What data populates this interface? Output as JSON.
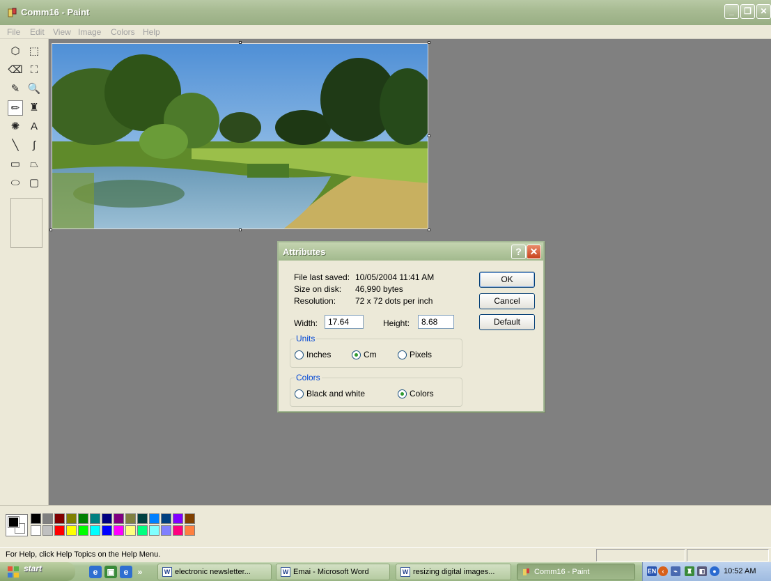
{
  "window": {
    "title": "Comm16  - Paint"
  },
  "menu": [
    "File",
    "Edit",
    "View",
    "Image",
    "Colors",
    "Help"
  ],
  "tools": [
    {
      "name": "free-form-select-icon",
      "glyph": "⬡"
    },
    {
      "name": "select-icon",
      "glyph": "⬚"
    },
    {
      "name": "eraser-icon",
      "glyph": "⌫"
    },
    {
      "name": "fill-with-color-icon",
      "glyph": "⛶"
    },
    {
      "name": "pick-color-icon",
      "glyph": "✎"
    },
    {
      "name": "magnifier-icon",
      "glyph": "🔍"
    },
    {
      "name": "pencil-icon",
      "glyph": "✏"
    },
    {
      "name": "brush-icon",
      "glyph": "♜"
    },
    {
      "name": "airbrush-icon",
      "glyph": "✺"
    },
    {
      "name": "text-icon",
      "glyph": "A"
    },
    {
      "name": "line-icon",
      "glyph": "╲"
    },
    {
      "name": "curve-icon",
      "glyph": "∫"
    },
    {
      "name": "rectangle-icon",
      "glyph": "▭"
    },
    {
      "name": "polygon-icon",
      "glyph": "⏢"
    },
    {
      "name": "ellipse-icon",
      "glyph": "⬭"
    },
    {
      "name": "rounded-rectangle-icon",
      "glyph": "▢"
    }
  ],
  "palette": {
    "top": [
      "#000000",
      "#808080",
      "#800000",
      "#808000",
      "#008000",
      "#008080",
      "#000080",
      "#800080",
      "#808040",
      "#004040",
      "#0080ff",
      "#004080",
      "#8000ff",
      "#804000"
    ],
    "bottom": [
      "#ffffff",
      "#c0c0c0",
      "#ff0000",
      "#ffff00",
      "#00ff00",
      "#00ffff",
      "#0000ff",
      "#ff00ff",
      "#ffff80",
      "#00ff80",
      "#80ffff",
      "#8080ff",
      "#ff0080",
      "#ff8040"
    ]
  },
  "status": {
    "help": "For Help, click Help Topics on the Help Menu."
  },
  "dialog": {
    "title": "Attributes",
    "file_last_saved_label": "File last saved:",
    "file_last_saved_value": "10/05/2004 11:41 AM",
    "size_label": "Size on disk:",
    "size_value": "46,990 bytes",
    "resolution_label": "Resolution:",
    "resolution_value": "72 x 72 dots per inch",
    "width_label": "Width:",
    "width_value": "17.64",
    "height_label": "Height:",
    "height_value": "8.68",
    "units_title": "Units",
    "units": {
      "inches": "Inches",
      "cm": "Cm",
      "pixels": "Pixels",
      "selected": "Cm"
    },
    "colors_title": "Colors",
    "colors": {
      "bw": "Black and white",
      "colors": "Colors",
      "selected": "Colors"
    },
    "ok": "OK",
    "cancel": "Cancel",
    "default": "Default"
  },
  "taskbar": {
    "start": "start",
    "tasks": [
      {
        "label": "electronic newsletter..."
      },
      {
        "label": "Emai - Microsoft Word"
      },
      {
        "label": "resizing digital images..."
      },
      {
        "label": "Comm16  - Paint"
      }
    ],
    "lang": "EN",
    "clock": "10:52 AM"
  }
}
